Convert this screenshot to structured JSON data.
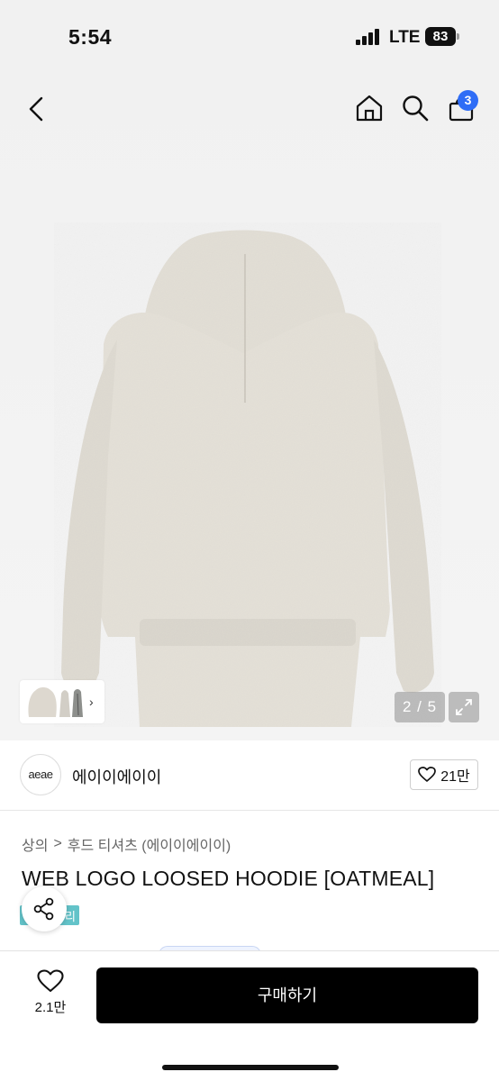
{
  "status_bar": {
    "time": "5:54",
    "network": "LTE",
    "battery": "83"
  },
  "nav": {
    "cart_count": "3"
  },
  "gallery": {
    "counter": "2 / 5"
  },
  "brand": {
    "logo_text": "aeae",
    "name": "에이이에이이",
    "like_count": "21만"
  },
  "breadcrumb": {
    "level1": "상의",
    "separator": ">",
    "level2": "후드 티셔츠 (에이이에이이)"
  },
  "product": {
    "title": "WEB LOGO LOOSED HOODIE [OATMEAL]",
    "tag_text": "리"
  },
  "bottom_bar": {
    "wish_count": "2.1만",
    "buy_label": "구매하기"
  },
  "colors": {
    "accent_blue": "#2f6df6",
    "buy_button": "#000000",
    "tag_teal": "#63c3c9",
    "hoodie": "#e3dfd6"
  }
}
